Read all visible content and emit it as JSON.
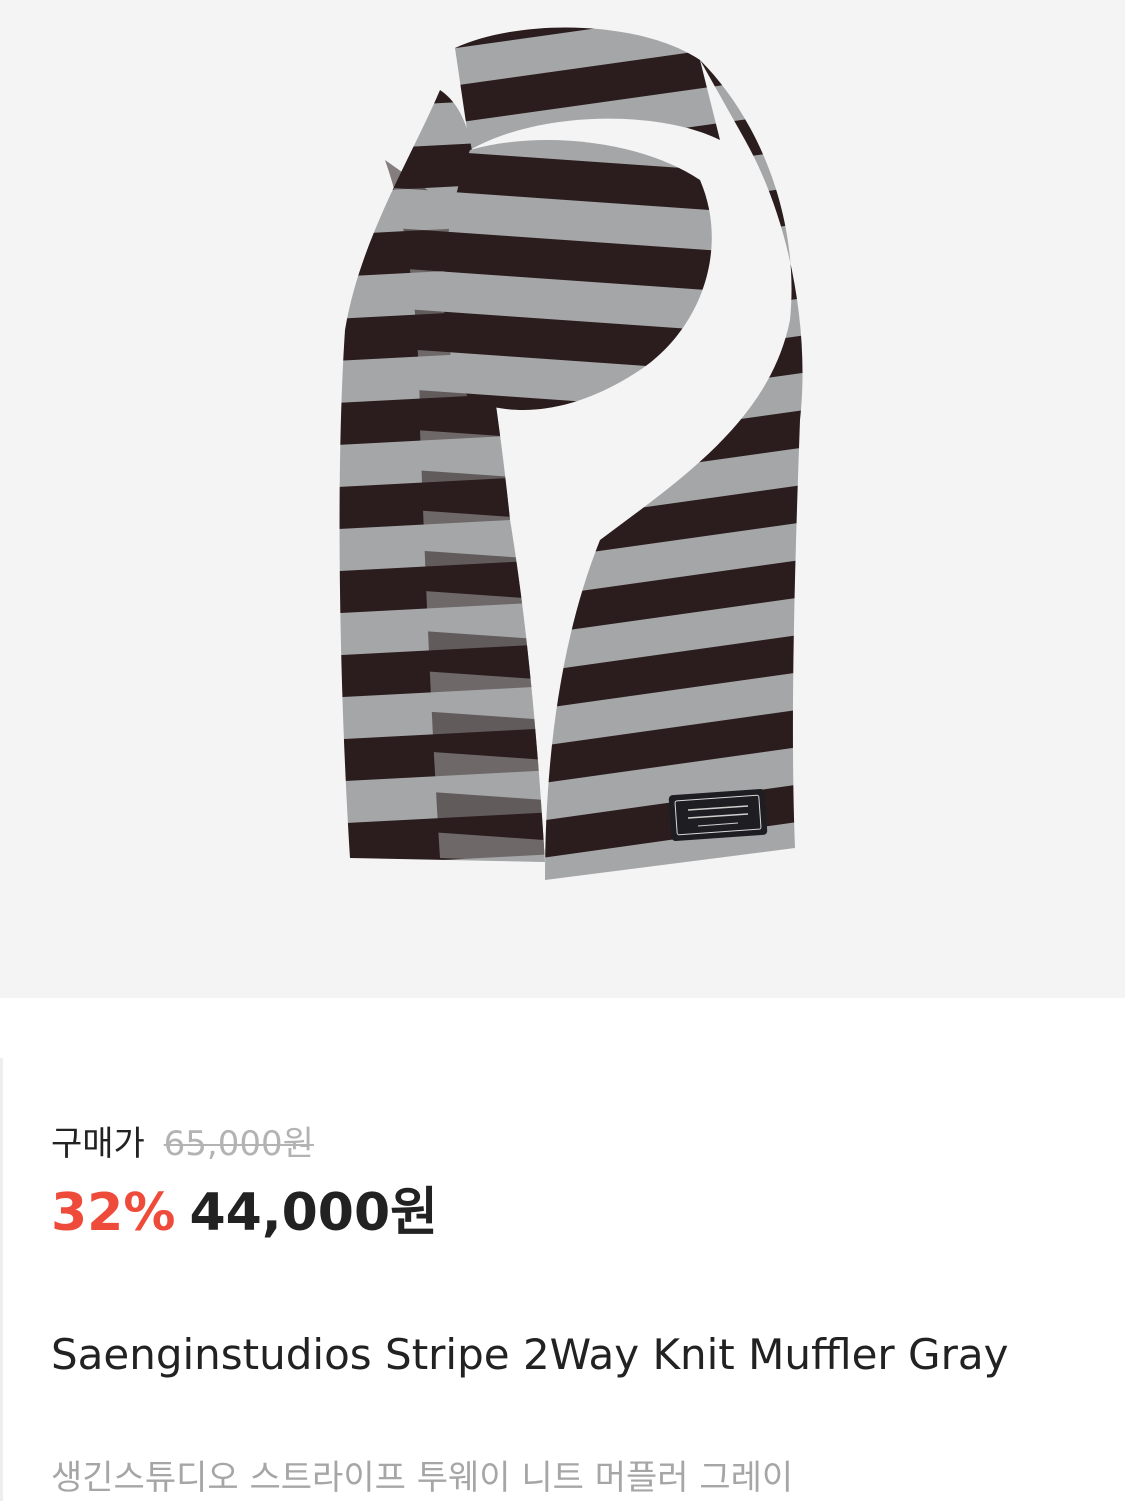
{
  "product": {
    "image_alt": "striped knit muffler",
    "image_colors": {
      "background": "#f4f4f4",
      "stripe_dark": "#2b1d1d",
      "stripe_light": "#a5a6a8"
    },
    "price_label": "구매가",
    "original_price": "65,000원",
    "discount_rate": "32%",
    "sale_price": "44,000원",
    "name_en": "Saenginstudios Stripe 2Way Knit Muffler Gray",
    "name_ko": "생긴스튜디오 스트라이프 투웨이 니트 머플러 그레이"
  },
  "colors": {
    "accent_discount": "#ef4b3a",
    "text_primary": "#222222",
    "text_muted": "#a6a6a6"
  }
}
